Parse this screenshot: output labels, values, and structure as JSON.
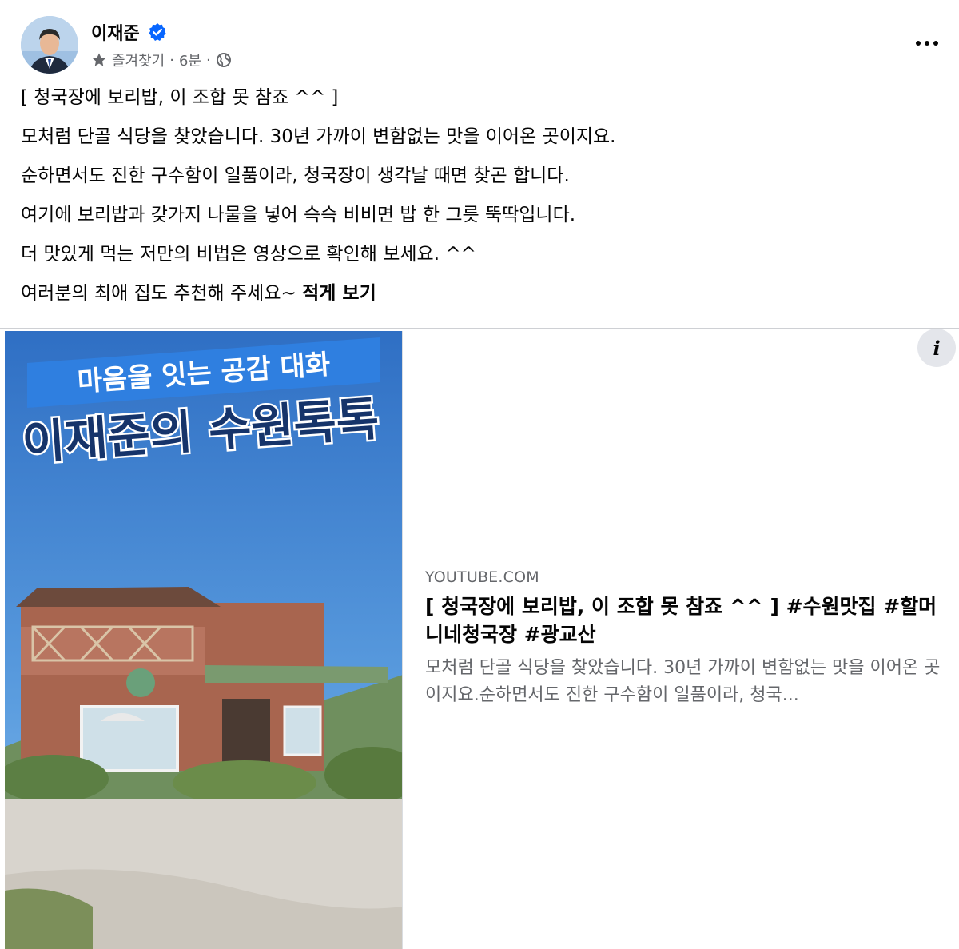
{
  "post": {
    "author": "이재준",
    "verified_icon": "verified-badge-icon",
    "favorite_label": "즐겨찾기",
    "separator": "·",
    "time": "6분",
    "audience_icon": "globe-icon",
    "more_icon": "more-options-icon",
    "lines": [
      "[ 청국장에 보리밥, 이 조합 못 참죠 ^^ ]",
      "모처럼 단골 식당을 찾았습니다. 30년 가까이 변함없는 맛을 이어온 곳이지요.",
      "순하면서도 진한 구수함이 일품이라, 청국장이 생각날 때면 찾곤 합니다.",
      "여기에 보리밥과 갖가지 나물을 넣어 슥슥 비비면 밥 한 그릇 뚝딱입니다.",
      "더 맛있게 먹는 저만의 비법은 영상으로 확인해 보세요. ^^",
      "여러분의 최애 집도 추천해 주세요~"
    ],
    "see_less": "적게 보기"
  },
  "link_preview": {
    "thumbnail": {
      "subtitle": "마음을 잇는 공감 대화",
      "title": "이재준의 수원톡톡"
    },
    "info_icon": "info-icon",
    "info_label": "i",
    "domain": "YOUTUBE.COM",
    "title": "[ 청국장에 보리밥, 이 조합 못 참죠 ^^ ] #수원맛집 #할머니네청국장 #광교산",
    "snippet": "모처럼 단골 식당을 찾았습니다. 30년 가까이 변함없는 맛을 이어온 곳이지요.순하면서도 진한 구수함이 일품이라, 청국..."
  },
  "colors": {
    "accent": "#0866ff",
    "secondary_text": "#65676b",
    "sky": "#4e8fd4",
    "banner": "#2f7fe0"
  }
}
